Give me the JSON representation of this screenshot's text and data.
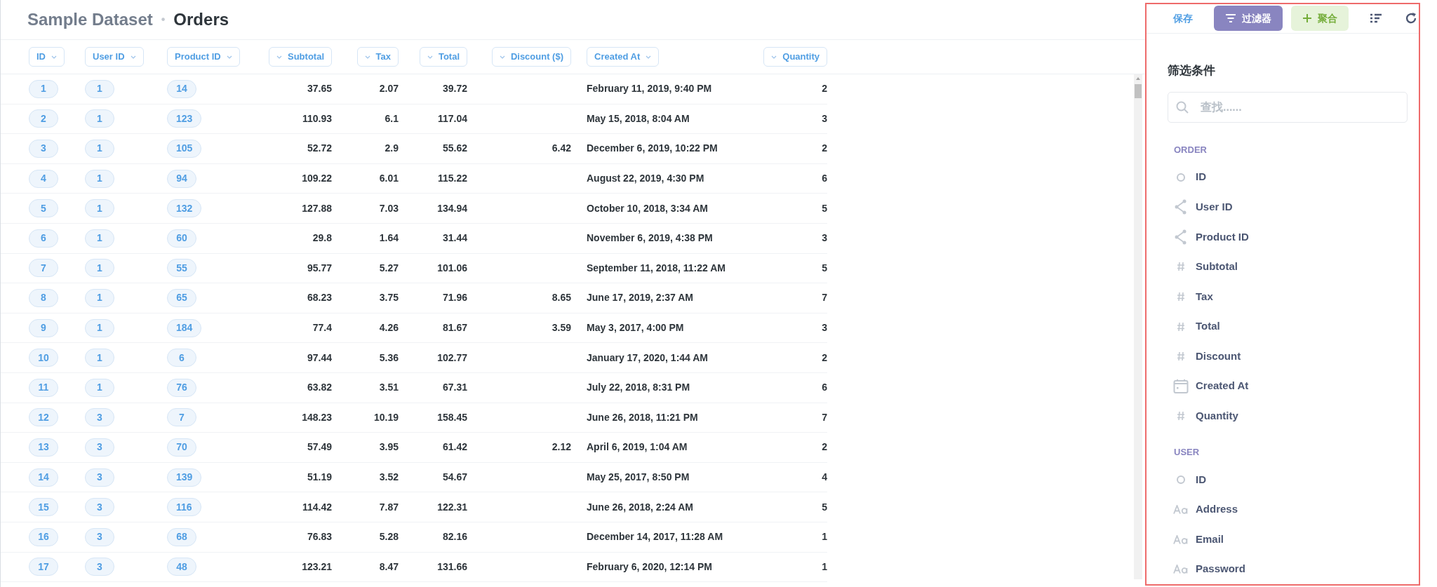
{
  "breadcrumb": {
    "database": "Sample Dataset",
    "separator": "•",
    "table": "Orders"
  },
  "toolbar": {
    "save": "保存",
    "buttons": [
      {
        "kind": "filter",
        "label": "过滤器",
        "selected": true
      },
      {
        "kind": "summarize",
        "label": "聚合",
        "selected": false
      }
    ]
  },
  "table": {
    "columns": [
      {
        "label": "ID",
        "kind": "text"
      },
      {
        "label": "User ID",
        "kind": "text"
      },
      {
        "label": "Product ID",
        "kind": "text"
      },
      {
        "label": "Subtotal",
        "kind": "number"
      },
      {
        "label": "Tax",
        "kind": "number"
      },
      {
        "label": "Total",
        "kind": "number"
      },
      {
        "label": "Discount ($)",
        "kind": "number"
      },
      {
        "label": "Created At",
        "kind": "text"
      },
      {
        "label": "Quantity",
        "kind": "number"
      }
    ],
    "rows": [
      {
        "id": "1",
        "user_id": "1",
        "product_id": "14",
        "subtotal": "37.65",
        "tax": "2.07",
        "total": "39.72",
        "created_at": "February 11, 2019, 9:40 PM",
        "quantity": "2"
      },
      {
        "id": "2",
        "user_id": "1",
        "product_id": "123",
        "subtotal": "110.93",
        "tax": "6.1",
        "total": "117.04",
        "created_at": "May 15, 2018, 8:04 AM",
        "quantity": "3"
      },
      {
        "id": "3",
        "user_id": "1",
        "product_id": "105",
        "subtotal": "52.72",
        "tax": "2.9",
        "total": "55.62",
        "discount": "6.42",
        "created_at": "December 6, 2019, 10:22 PM",
        "quantity": "2"
      },
      {
        "id": "4",
        "user_id": "1",
        "product_id": "94",
        "subtotal": "109.22",
        "tax": "6.01",
        "total": "115.22",
        "created_at": "August 22, 2019, 4:30 PM",
        "quantity": "6"
      },
      {
        "id": "5",
        "user_id": "1",
        "product_id": "132",
        "subtotal": "127.88",
        "tax": "7.03",
        "total": "134.94",
        "created_at": "October 10, 2018, 3:34 AM",
        "quantity": "5"
      },
      {
        "id": "6",
        "user_id": "1",
        "product_id": "60",
        "subtotal": "29.8",
        "tax": "1.64",
        "total": "31.44",
        "created_at": "November 6, 2019, 4:38 PM",
        "quantity": "3"
      },
      {
        "id": "7",
        "user_id": "1",
        "product_id": "55",
        "subtotal": "95.77",
        "tax": "5.27",
        "total": "101.06",
        "created_at": "September 11, 2018, 11:22 AM",
        "quantity": "5"
      },
      {
        "id": "8",
        "user_id": "1",
        "product_id": "65",
        "subtotal": "68.23",
        "tax": "3.75",
        "total": "71.96",
        "discount": "8.65",
        "created_at": "June 17, 2019, 2:37 AM",
        "quantity": "7"
      },
      {
        "id": "9",
        "user_id": "1",
        "product_id": "184",
        "subtotal": "77.4",
        "tax": "4.26",
        "total": "81.67",
        "discount": "3.59",
        "created_at": "May 3, 2017, 4:00 PM",
        "quantity": "3"
      },
      {
        "id": "10",
        "user_id": "1",
        "product_id": "6",
        "subtotal": "97.44",
        "tax": "5.36",
        "total": "102.77",
        "created_at": "January 17, 2020, 1:44 AM",
        "quantity": "2"
      },
      {
        "id": "11",
        "user_id": "1",
        "product_id": "76",
        "subtotal": "63.82",
        "tax": "3.51",
        "total": "67.31",
        "created_at": "July 22, 2018, 8:31 PM",
        "quantity": "6"
      },
      {
        "id": "12",
        "user_id": "3",
        "product_id": "7",
        "subtotal": "148.23",
        "tax": "10.19",
        "total": "158.45",
        "created_at": "June 26, 2018, 11:21 PM",
        "quantity": "7"
      },
      {
        "id": "13",
        "user_id": "3",
        "product_id": "70",
        "subtotal": "57.49",
        "tax": "3.95",
        "total": "61.42",
        "discount": "2.12",
        "created_at": "April 6, 2019, 1:04 AM",
        "quantity": "2"
      },
      {
        "id": "14",
        "user_id": "3",
        "product_id": "139",
        "subtotal": "51.19",
        "tax": "3.52",
        "total": "54.67",
        "created_at": "May 25, 2017, 8:50 PM",
        "quantity": "4"
      },
      {
        "id": "15",
        "user_id": "3",
        "product_id": "116",
        "subtotal": "114.42",
        "tax": "7.87",
        "total": "122.31",
        "created_at": "June 26, 2018, 2:24 AM",
        "quantity": "5"
      },
      {
        "id": "16",
        "user_id": "3",
        "product_id": "68",
        "subtotal": "76.83",
        "tax": "5.28",
        "total": "82.16",
        "created_at": "December 14, 2017, 11:28 AM",
        "quantity": "1"
      },
      {
        "id": "17",
        "user_id": "3",
        "product_id": "48",
        "subtotal": "123.21",
        "tax": "8.47",
        "total": "131.66",
        "created_at": "February 6, 2020, 12:14 PM",
        "quantity": "1"
      }
    ]
  },
  "filter_panel": {
    "title": "筛选条件",
    "search": {
      "placeholder": "查找......"
    },
    "sections": [
      {
        "title": "ORDER",
        "items": [
          {
            "kind": "id",
            "label": "ID"
          },
          {
            "kind": "fk",
            "label": "User ID"
          },
          {
            "kind": "fk",
            "label": "Product ID"
          },
          {
            "kind": "number",
            "label": "Subtotal"
          },
          {
            "kind": "number",
            "label": "Tax"
          },
          {
            "kind": "number",
            "label": "Total"
          },
          {
            "kind": "number",
            "label": "Discount"
          },
          {
            "kind": "date",
            "label": "Created At"
          },
          {
            "kind": "number",
            "label": "Quantity"
          }
        ]
      },
      {
        "title": "USER",
        "items": [
          {
            "kind": "id",
            "label": "ID"
          },
          {
            "kind": "text",
            "label": "Address"
          },
          {
            "kind": "text",
            "label": "Email"
          },
          {
            "kind": "text",
            "label": "Password"
          }
        ]
      }
    ]
  }
}
